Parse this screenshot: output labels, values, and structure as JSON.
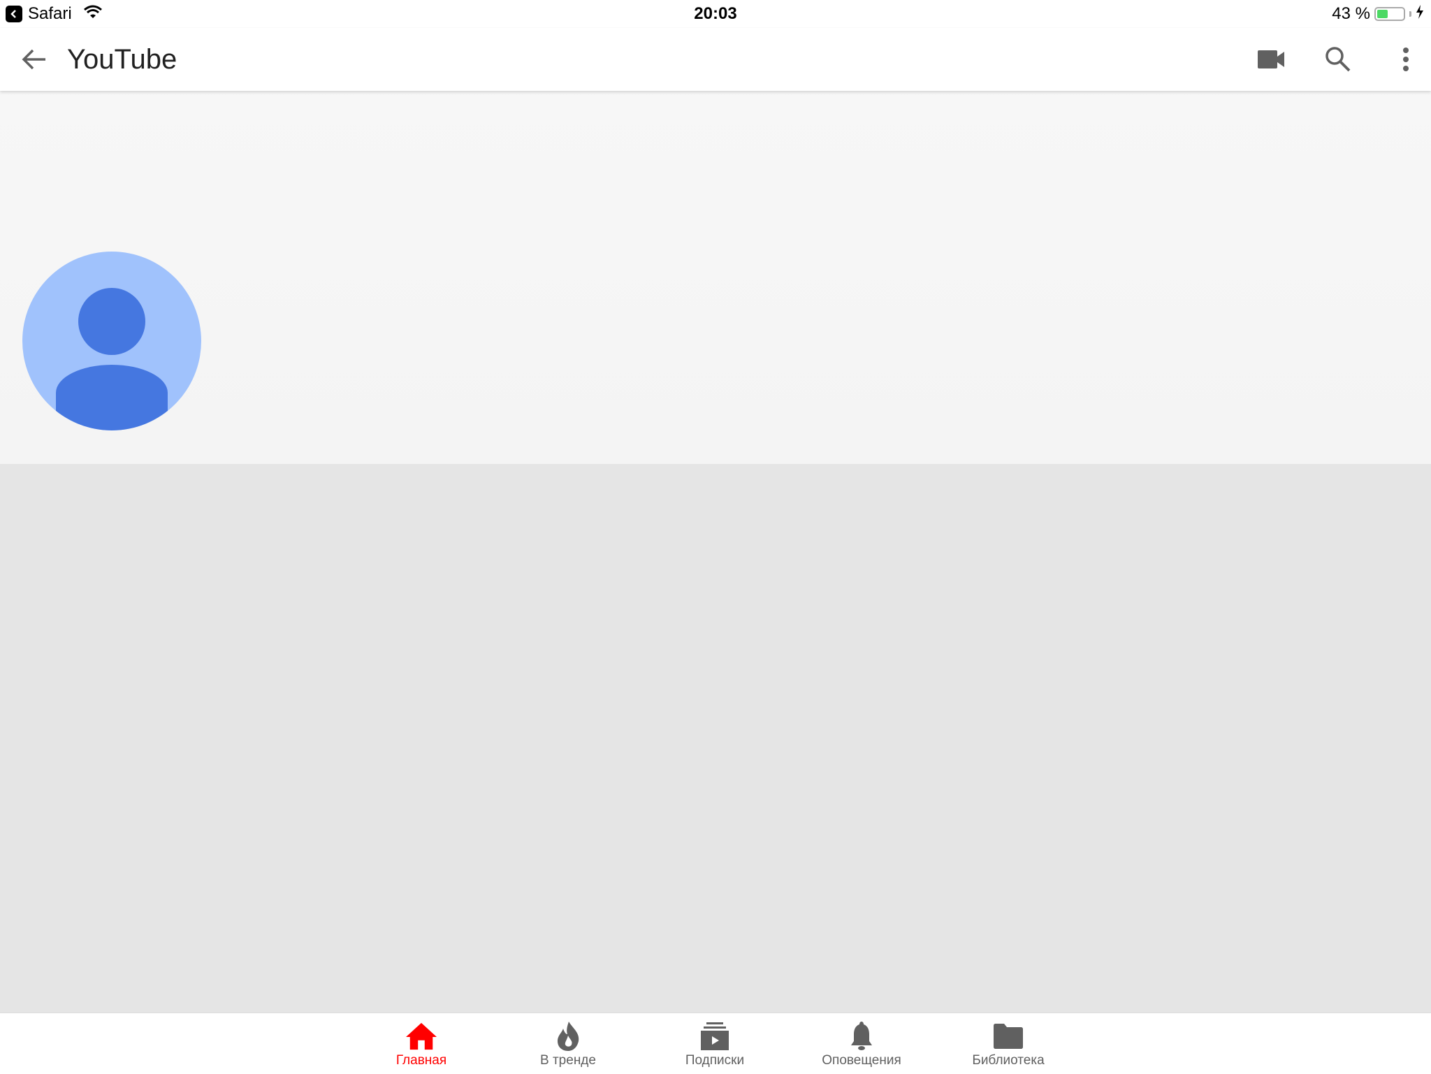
{
  "status_bar": {
    "back_app": "Safari",
    "time": "20:03",
    "battery_text": "43 %",
    "battery_level": 0.43,
    "charging": true
  },
  "app_bar": {
    "title": "YouTube",
    "icons": [
      "back-arrow-icon",
      "video-camera-icon",
      "search-icon",
      "more-vert-icon"
    ]
  },
  "channel": {
    "avatar": "default-user-avatar",
    "avatar_bg": "#a0c2fc",
    "avatar_fg": "#4577e0"
  },
  "bottom_nav": {
    "active_color": "#ff0000",
    "inactive_color": "#606060",
    "items": [
      {
        "label": "Главная",
        "icon": "home-icon",
        "active": true
      },
      {
        "label": "В тренде",
        "icon": "flame-icon",
        "active": false
      },
      {
        "label": "Подписки",
        "icon": "subscriptions-icon",
        "active": false
      },
      {
        "label": "Оповещения",
        "icon": "bell-icon",
        "active": false
      },
      {
        "label": "Библиотека",
        "icon": "folder-icon",
        "active": false
      }
    ]
  }
}
